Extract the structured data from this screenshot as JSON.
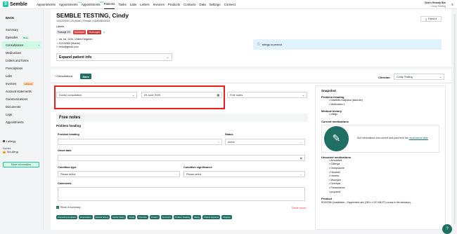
{
  "app": {
    "logo_text": "Semble",
    "logo_mark": "S"
  },
  "nav": {
    "items": [
      {
        "label": "Appointments",
        "sup": ""
      },
      {
        "label": "Appointments",
        "sup": "New"
      },
      {
        "label": "Appointments",
        "sup": "NEW"
      },
      {
        "label": "Patients",
        "sup": ""
      },
      {
        "label": "Tasks",
        "sup": ""
      },
      {
        "label": "Labs",
        "sup": ""
      },
      {
        "label": "Letters",
        "sup": ""
      },
      {
        "label": "Invoices",
        "sup": ""
      },
      {
        "label": "Products",
        "sup": ""
      },
      {
        "label": "Contacts",
        "sup": ""
      },
      {
        "label": "Data",
        "sup": ""
      },
      {
        "label": "Settings",
        "sup": ""
      },
      {
        "label": "Connect",
        "sup": ""
      }
    ],
    "user_name": "Clea's Beauty Bar",
    "user_sub": "Cindy Testing"
  },
  "sidebar": {
    "back": "BACK",
    "items": [
      {
        "label": "Summary"
      },
      {
        "label": "Episodes",
        "badge": "Beta"
      },
      {
        "label": "Consultations",
        "active": true
      },
      {
        "label": "Medications"
      },
      {
        "label": "Letters and forms"
      },
      {
        "label": "Prescriptions"
      },
      {
        "label": "Labs"
      },
      {
        "label": "Invoices",
        "badge_o": "£450.00"
      },
      {
        "label": "Account statements"
      },
      {
        "label": "Communications"
      },
      {
        "label": "Documents"
      },
      {
        "label": "Logs"
      },
      {
        "label": "Appointments"
      }
    ],
    "allergy_title": "1 allergy",
    "allergy_current": "Current",
    "allergy_item": "Nut allergy",
    "more_info": "More information"
  },
  "patient": {
    "name": "SEMBLE TESTING, Cindy",
    "info": "10/02/2000  |  25 years  |  Female  |  IQMWBX3ED4",
    "labels_title": "Labels",
    "chips": [
      "Package 2/3",
      "Deceased",
      "Discharged"
    ],
    "address": "na, na, 1234, United Kingdom",
    "phone": "01234569 (Mobile)",
    "email": "hello@gmail.com",
    "handit": "Hand it",
    "expand": "Expand patient info",
    "allergy_banner": "allergy to peanut"
  },
  "toolbar": {
    "back_label": "Consultations",
    "save": "Save",
    "clinician_label": "Clinician",
    "clinician_value": "Cindy Testing"
  },
  "consult": {
    "type": "Doctor consultation",
    "date": "23 June 2025",
    "template": "Free notes"
  },
  "form": {
    "title": "Free notes",
    "section": "Problem heading",
    "problem_heading": "Problem heading",
    "status": "Status",
    "status_value": "Active",
    "onset": "Onset date",
    "condition_type": "Condition type",
    "condition_type_value": "Please select",
    "condition_sig": "Condition significance",
    "condition_sig_value": "Please select",
    "comments": "Comments",
    "show_summary": "Show in summary",
    "delete": "Delete record",
    "tags": [
      "Presenting complaint",
      "Examination",
      "Medical history",
      "Family history",
      "Social",
      "Prescribe",
      "Product",
      "Comment",
      "Problem heading",
      "Allergy",
      "Patient signature",
      "Diagram"
    ]
  },
  "snapshot": {
    "title": "Snapshot",
    "problem_heading": "Problem heading",
    "problems": [
      "Diabetes Insipidus (disorder)",
      "Medication 1"
    ],
    "med_history": "Medical history",
    "history": [
      "vitiligo"
    ],
    "current_meds": "Current medications",
    "med_text": "Sort medications into current and past from the",
    "med_link": "medications table",
    "unsorted": "Unsorted medications",
    "unsorted_list": [
      "Amoxilline",
      "Gillenya",
      "Omeprazole",
      "Hirudoid",
      "Humira",
      "Mounjaro",
      "Ozempic",
      "Paracetamol",
      "propanol"
    ],
    "product": "Product",
    "footer": "ROS0296 Quantitative – Supplement zinc (280 x 4 GO MILST) course in the laboratory..."
  },
  "colors": {
    "accent": "#1f6f64",
    "brand": "#22c3a6",
    "highlight": "#ef1c1c"
  }
}
